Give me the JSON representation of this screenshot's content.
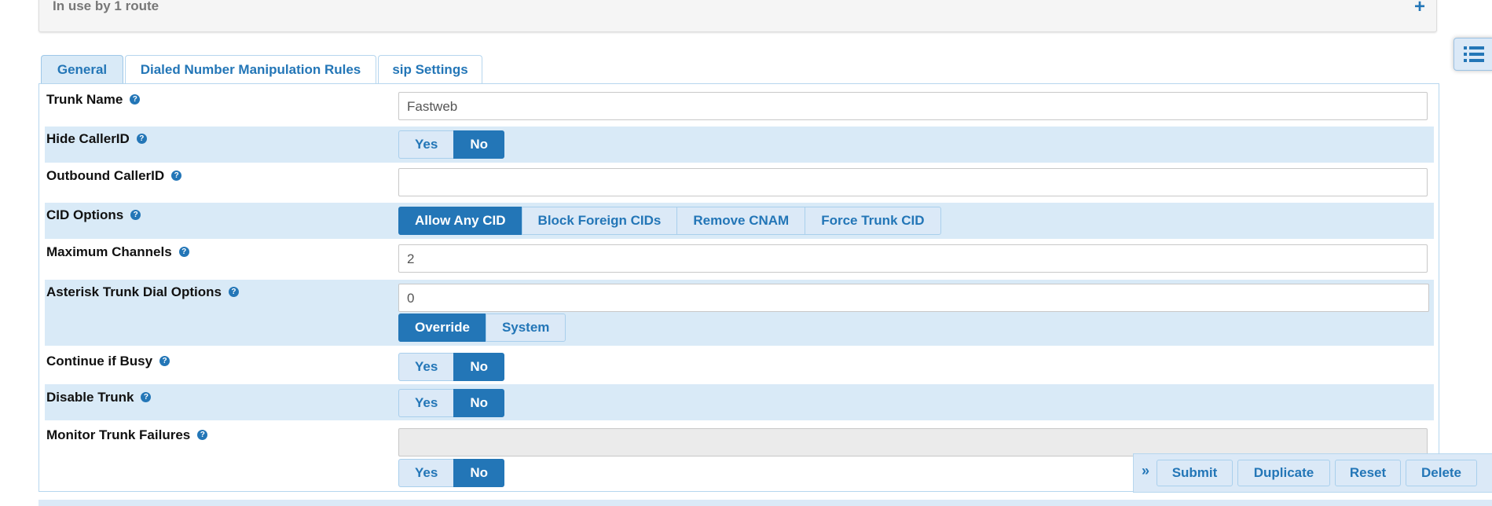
{
  "top_panel": {
    "status": "In use by 1 route",
    "expand_icon": "+"
  },
  "float_button": {
    "icon": "list-icon"
  },
  "tabs": [
    {
      "label": "General",
      "active": true
    },
    {
      "label": "Dialed Number Manipulation Rules",
      "active": false
    },
    {
      "label": "sip Settings",
      "active": false
    }
  ],
  "form": {
    "trunk_name": {
      "label": "Trunk Name",
      "value": "Fastweb"
    },
    "hide_callerid": {
      "label": "Hide CallerID",
      "options": [
        "Yes",
        "No"
      ],
      "selected": "No"
    },
    "outbound_callerid": {
      "label": "Outbound CallerID",
      "value": ""
    },
    "cid_options": {
      "label": "CID Options",
      "options": [
        "Allow Any CID",
        "Block Foreign CIDs",
        "Remove CNAM",
        "Force Trunk CID"
      ],
      "selected": "Allow Any CID"
    },
    "max_channels": {
      "label": "Maximum Channels",
      "value": "2"
    },
    "dial_options": {
      "label": "Asterisk Trunk Dial Options",
      "value": "0",
      "options": [
        "Override",
        "System"
      ],
      "selected": "Override"
    },
    "continue_if_busy": {
      "label": "Continue if Busy",
      "options": [
        "Yes",
        "No"
      ],
      "selected": "No"
    },
    "disable_trunk": {
      "label": "Disable Trunk",
      "options": [
        "Yes",
        "No"
      ],
      "selected": "No"
    },
    "monitor_failures": {
      "label": "Monitor Trunk Failures",
      "value": "",
      "options": [
        "Yes",
        "No"
      ],
      "selected": "No"
    },
    "help_icon": "?"
  },
  "actions": {
    "expand_icon": "»",
    "submit": "Submit",
    "duplicate": "Duplicate",
    "reset": "Reset",
    "delete": "Delete"
  },
  "colors": {
    "accent": "#2376b7",
    "row_shade": "#d9eaf7"
  }
}
